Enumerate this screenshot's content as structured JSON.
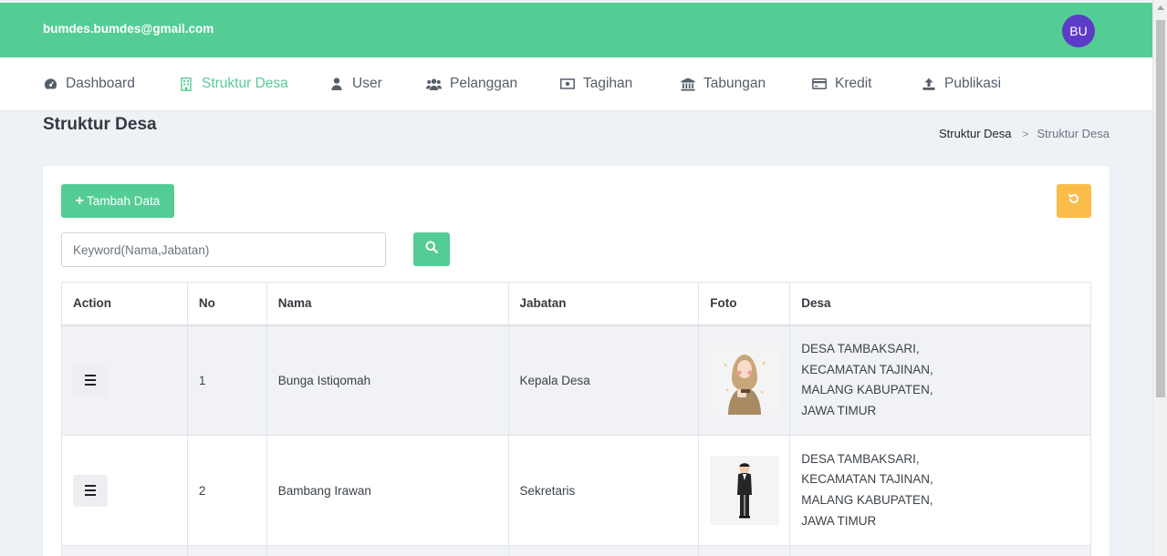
{
  "header": {
    "email": "bumdes.bumdes@gmail.com",
    "avatar_initials": "BU",
    "color": "#54cc96"
  },
  "nav": [
    {
      "label": "Dashboard",
      "icon": "tachometer-icon"
    },
    {
      "label": "Struktur Desa",
      "icon": "building-icon",
      "active": true
    },
    {
      "label": "User",
      "icon": "user-icon"
    },
    {
      "label": "Pelanggan",
      "icon": "users-icon"
    },
    {
      "label": "Tagihan",
      "icon": "money-bill-icon"
    },
    {
      "label": "Tabungan",
      "icon": "bank-icon"
    },
    {
      "label": "Kredit",
      "icon": "credit-card-icon"
    },
    {
      "label": "Publikasi",
      "icon": "upload-icon"
    }
  ],
  "page": {
    "title": "Struktur Desa",
    "breadcrumb": {
      "parent": "Struktur Desa",
      "current": "Struktur Desa"
    }
  },
  "toolbar": {
    "add_label": "Tambah Data",
    "search_placeholder": "Keyword(Nama,Jabatan)",
    "search_value": ""
  },
  "table": {
    "headers": {
      "action": "Action",
      "no": "No",
      "nama": "Nama",
      "jabatan": "Jabatan",
      "foto": "Foto",
      "desa": "Desa"
    },
    "rows": [
      {
        "no": "1",
        "nama": "Bunga Istiqomah",
        "jabatan": "Kepala Desa",
        "foto": "hijab-woman-photo",
        "desa": [
          "DESA TAMBAKSARI,",
          "KECAMATAN TAJINAN,",
          "MALANG KABUPATEN,",
          "JAWA TIMUR"
        ]
      },
      {
        "no": "2",
        "nama": "Bambang Irawan",
        "jabatan": "Sekretaris",
        "foto": "man-in-suit-photo",
        "desa": [
          "DESA TAMBAKSARI,",
          "KECAMATAN TAJINAN,",
          "MALANG KABUPATEN,",
          "JAWA TIMUR"
        ]
      }
    ]
  },
  "colors": {
    "primary": "#54cc96",
    "warning": "#fbbd4a",
    "avatar": "#5b3cc4"
  }
}
